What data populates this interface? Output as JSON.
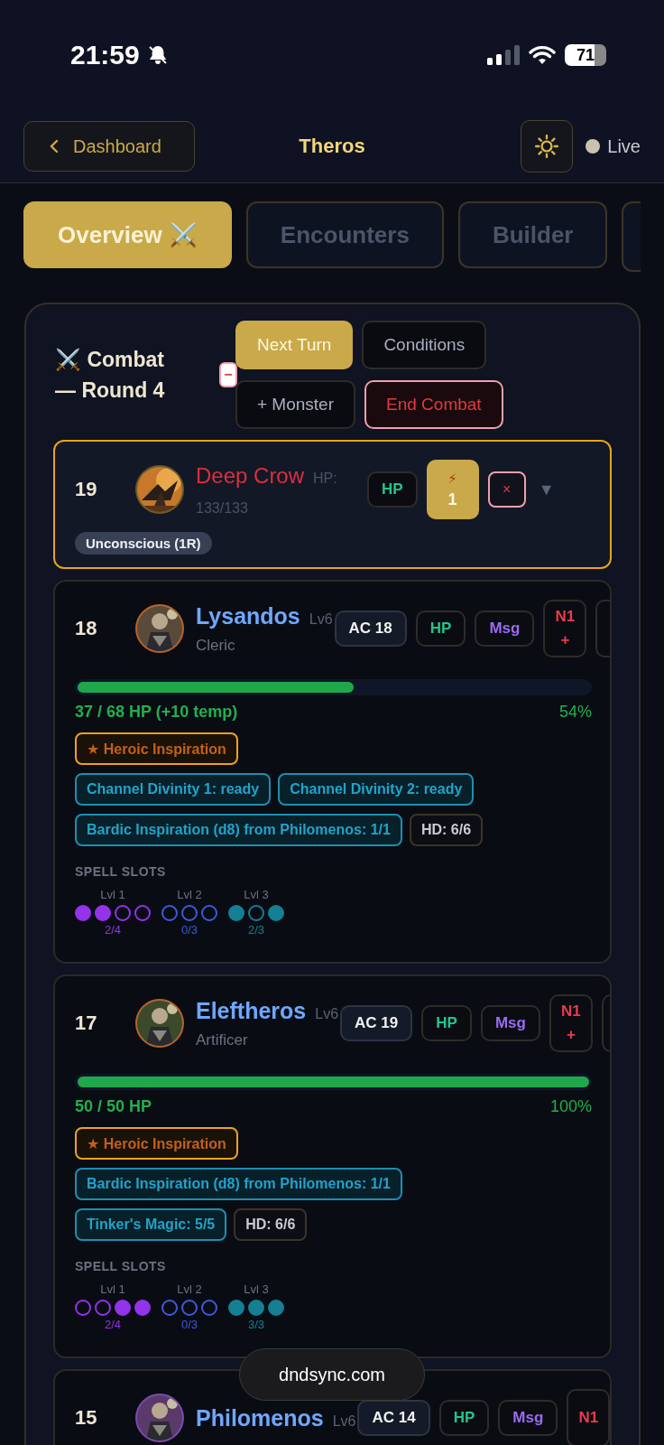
{
  "status_bar": {
    "time": "21:59",
    "battery": "71"
  },
  "header": {
    "back_label": "Dashboard",
    "title": "Theros",
    "live_label": "Live"
  },
  "tabs": [
    {
      "label": "Overview ⚔️",
      "selected": true
    },
    {
      "label": "Encounters",
      "selected": false
    },
    {
      "label": "Builder",
      "selected": false
    }
  ],
  "combat": {
    "title": "⚔️ Combat — Round 4",
    "collapse_label": "−",
    "actions": [
      {
        "label": "Next Turn",
        "kind": "primary"
      },
      {
        "label": "Conditions",
        "kind": "plain"
      },
      {
        "label": "+ Monster",
        "kind": "plain"
      },
      {
        "label": "End Combat",
        "kind": "danger"
      }
    ],
    "monster": {
      "initiative": "19",
      "name": "Deep Crow",
      "hp_label": "HP:",
      "hp_value": "133/133",
      "hp_button": "HP",
      "action_icon": "⚡",
      "action_count": "1",
      "remove_label": "×",
      "expand_label": "▼",
      "conditions": [
        "Unconscious (1R)"
      ]
    },
    "characters": [
      {
        "initiative": "18",
        "name": "Lysandos",
        "level": "Lv6",
        "class": "Cleric",
        "ac": "AC 18",
        "hp_button": "HP",
        "msg_button": "Msg",
        "note_label": "N1",
        "note_add": "+",
        "hp": {
          "level": 0.54,
          "text": "37 / 68 HP (+10 temp)",
          "percent": "54%"
        },
        "tags": [
          {
            "kind": "heroic",
            "label": "★ Heroic Inspiration"
          },
          {
            "kind": "resource",
            "label": "Channel Divinity 1: ready"
          },
          {
            "kind": "resource",
            "label": "Channel Divinity 2: ready"
          },
          {
            "kind": "resource",
            "label": "Bardic Inspiration (d8) from Philomenos: 1/1"
          },
          {
            "kind": "neutral",
            "label": "HD: 6/6"
          }
        ],
        "spell_slots_label": "SPELL SLOTS",
        "slots": [
          {
            "label": "Lvl 1",
            "color": "#9333ea",
            "filled": [
              true,
              true,
              false,
              false
            ],
            "count": "2/4"
          },
          {
            "label": "Lvl 2",
            "color": "#3b5bdb",
            "filled": [
              false,
              false,
              false
            ],
            "count": "0/3"
          },
          {
            "label": "Lvl 3",
            "color": "#157f94",
            "filled": [
              true,
              false,
              true
            ],
            "count": "2/3"
          }
        ]
      },
      {
        "initiative": "17",
        "name": "Eleftheros",
        "level": "Lv6",
        "class": "Artificer",
        "ac": "AC 19",
        "hp_button": "HP",
        "msg_button": "Msg",
        "note_label": "N1",
        "note_add": "+",
        "hp": {
          "level": 1.0,
          "text": "50 / 50 HP",
          "percent": "100%"
        },
        "tags": [
          {
            "kind": "heroic",
            "label": "★ Heroic Inspiration"
          },
          {
            "kind": "resource",
            "label": "Bardic Inspiration (d8) from Philomenos: 1/1"
          },
          {
            "kind": "resource",
            "label": "Tinker's Magic: 5/5"
          },
          {
            "kind": "neutral",
            "label": "HD: 6/6"
          }
        ],
        "spell_slots_label": "SPELL SLOTS",
        "slots": [
          {
            "label": "Lvl 1",
            "color": "#9333ea",
            "filled": [
              false,
              false,
              true,
              true
            ],
            "count": "2/4"
          },
          {
            "label": "Lvl 2",
            "color": "#3b5bdb",
            "filled": [
              false,
              false,
              false
            ],
            "count": "0/3"
          },
          {
            "label": "Lvl 3",
            "color": "#157f94",
            "filled": [
              true,
              true,
              true
            ],
            "count": "3/3"
          }
        ]
      },
      {
        "initiative": "15",
        "name": "Philomenos",
        "level": "Lv6",
        "ac": "AC 14",
        "hp_button": "HP",
        "msg_button": "Msg",
        "note_label": "N1"
      }
    ]
  },
  "url_toast": "dndsync.com"
}
